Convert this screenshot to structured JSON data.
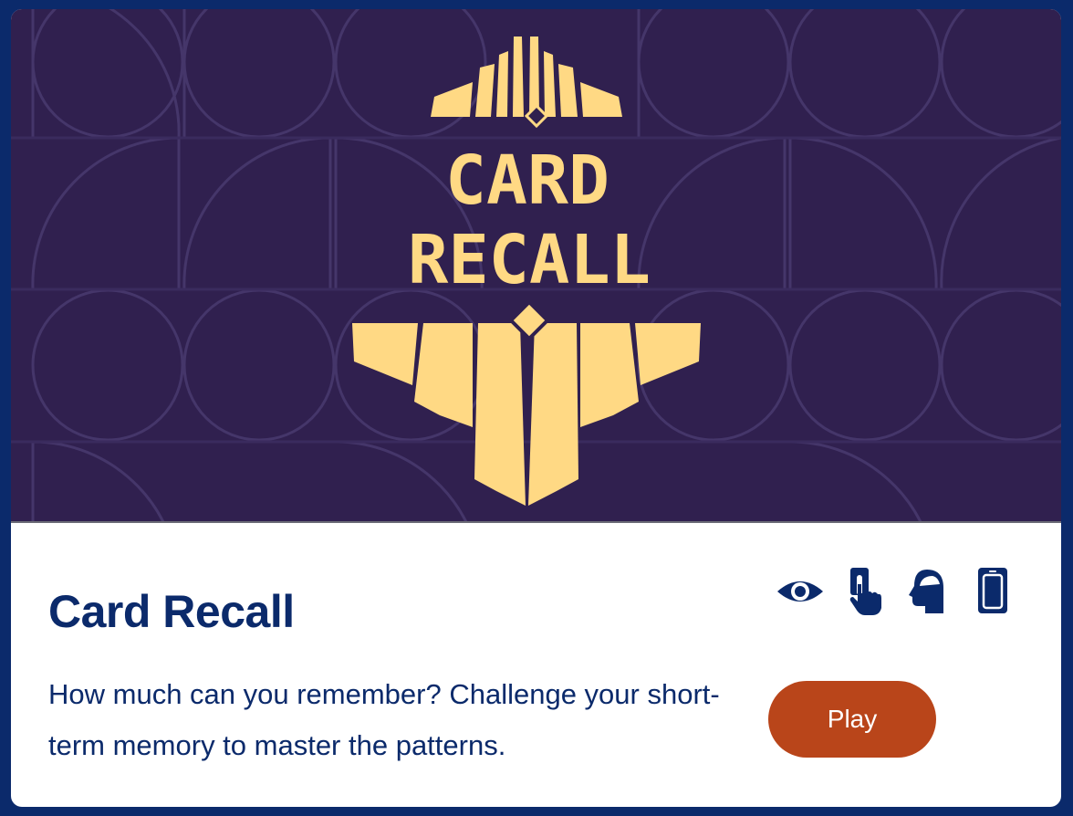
{
  "game": {
    "title": "Card Recall",
    "description": "How much can you remember? Challenge your short-term memory to master the patterns.",
    "play_label": "Play"
  },
  "banner": {
    "logo_line1": "CARD",
    "logo_line2": "RECALL",
    "background_color": "#30204f",
    "logo_color": "#ffd984"
  },
  "feature_icons": [
    "eye-icon",
    "tap-finger-icon",
    "head-memory-icon",
    "mobile-device-icon"
  ],
  "colors": {
    "frame": "#0b2a6b",
    "text": "#0b2a6b",
    "play_button": "#b9451a"
  }
}
